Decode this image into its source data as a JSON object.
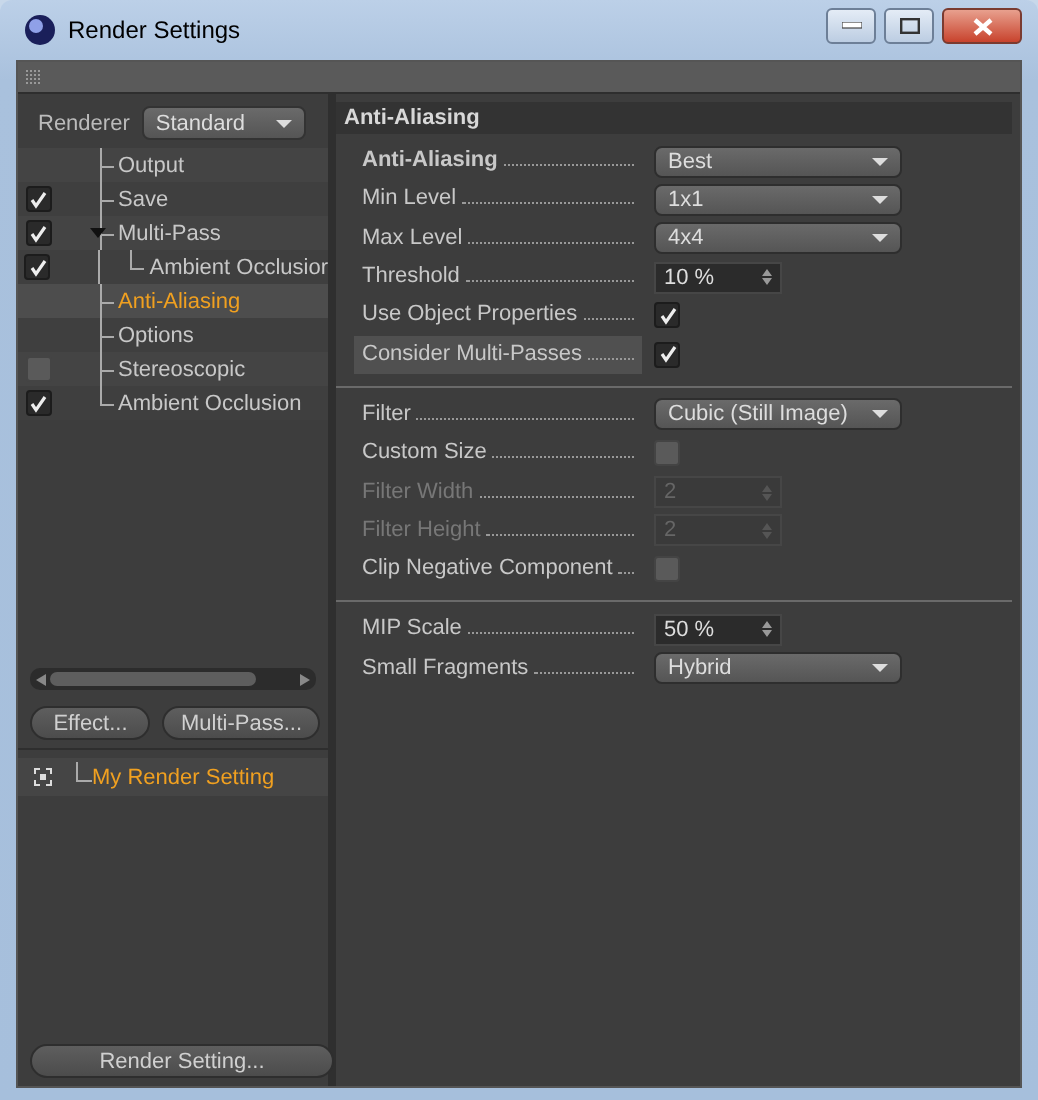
{
  "window": {
    "title": "Render Settings"
  },
  "renderer": {
    "label": "Renderer",
    "value": "Standard"
  },
  "tree": [
    {
      "label": "Output",
      "kind": "plain",
      "selected": false
    },
    {
      "label": "Save",
      "kind": "checkbox",
      "checked": true,
      "selected": false
    },
    {
      "label": "Multi-Pass",
      "kind": "checkbox",
      "checked": true,
      "selected": false,
      "expanded": true,
      "children": [
        {
          "label": "Ambient Occlusior",
          "kind": "checkbox",
          "checked": true,
          "selected": false
        }
      ]
    },
    {
      "label": "Anti-Aliasing",
      "kind": "plain",
      "selected": true
    },
    {
      "label": "Options",
      "kind": "plain",
      "selected": false
    },
    {
      "label": "Stereoscopic",
      "kind": "checkbox",
      "checked": false,
      "selected": false
    },
    {
      "label": "Ambient Occlusion",
      "kind": "checkbox",
      "checked": true,
      "selected": false
    }
  ],
  "buttons": [
    "Effect...",
    "Multi-Pass..."
  ],
  "settings_list": [
    {
      "label": "My Render Setting",
      "selected": true
    }
  ],
  "bottom_button": "Render Setting...",
  "panel": {
    "title": "Anti-Aliasing",
    "groups": [
      [
        {
          "label": "Anti-Aliasing",
          "kind": "dropdown",
          "value": "Best",
          "bold": true,
          "disabled": false,
          "highlighted": false
        },
        {
          "label": "Min Level",
          "kind": "dropdown",
          "value": "1x1",
          "bold": false,
          "disabled": false,
          "highlighted": false
        },
        {
          "label": "Max Level",
          "kind": "dropdown",
          "value": "4x4",
          "bold": false,
          "disabled": false,
          "highlighted": false
        },
        {
          "label": "Threshold",
          "kind": "number",
          "value": "10 %",
          "bold": false,
          "disabled": false,
          "highlighted": false
        },
        {
          "label": "Use Object Properties",
          "kind": "checkbox",
          "checked": true,
          "bold": false,
          "disabled": false,
          "highlighted": false
        },
        {
          "label": "Consider Multi-Passes",
          "kind": "checkbox",
          "checked": true,
          "bold": false,
          "disabled": false,
          "highlighted": true
        }
      ],
      [
        {
          "label": "Filter",
          "kind": "dropdown",
          "value": "Cubic (Still Image)",
          "bold": false,
          "disabled": false,
          "highlighted": false
        },
        {
          "label": "Custom Size",
          "kind": "checkbox",
          "checked": false,
          "bold": false,
          "disabled": false,
          "highlighted": false
        },
        {
          "label": "Filter Width",
          "kind": "number",
          "value": "2",
          "bold": false,
          "disabled": true,
          "highlighted": false
        },
        {
          "label": "Filter Height",
          "kind": "number",
          "value": "2",
          "bold": false,
          "disabled": true,
          "highlighted": false
        },
        {
          "label": "Clip Negative Component",
          "kind": "checkbox",
          "checked": false,
          "bold": false,
          "disabled": false,
          "highlighted": false
        }
      ],
      [
        {
          "label": "MIP Scale",
          "kind": "number",
          "value": "50 %",
          "bold": false,
          "disabled": false,
          "highlighted": false
        },
        {
          "label": "Small Fragments",
          "kind": "dropdown",
          "value": "Hybrid",
          "bold": false,
          "disabled": false,
          "highlighted": false
        }
      ]
    ]
  }
}
